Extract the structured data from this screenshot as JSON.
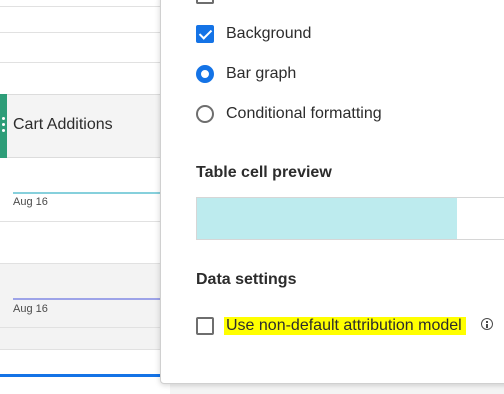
{
  "table": {
    "metric_title": "Cart Additions",
    "rows": [
      {
        "date": "Aug 16",
        "series": "teal"
      },
      {
        "date": "Aug 16",
        "series": "purple"
      }
    ]
  },
  "settings_panel": {
    "options": {
      "background": {
        "label": "Background",
        "checked": true
      },
      "bar_graph": {
        "label": "Bar graph",
        "selected": true
      },
      "conditional_formatting": {
        "label": "Conditional formatting",
        "selected": false
      }
    },
    "table_cell_preview": {
      "title": "Table cell preview",
      "bar_fill_fraction": 0.85
    },
    "data_settings": {
      "title": "Data settings",
      "non_default_attribution": {
        "label": "Use non-default attribution model",
        "checked": false
      }
    }
  },
  "colors": {
    "accent": "#1473e6",
    "handle": "#2d9d78",
    "preview_bar": "#bdebee",
    "highlight": "#ffff00"
  }
}
